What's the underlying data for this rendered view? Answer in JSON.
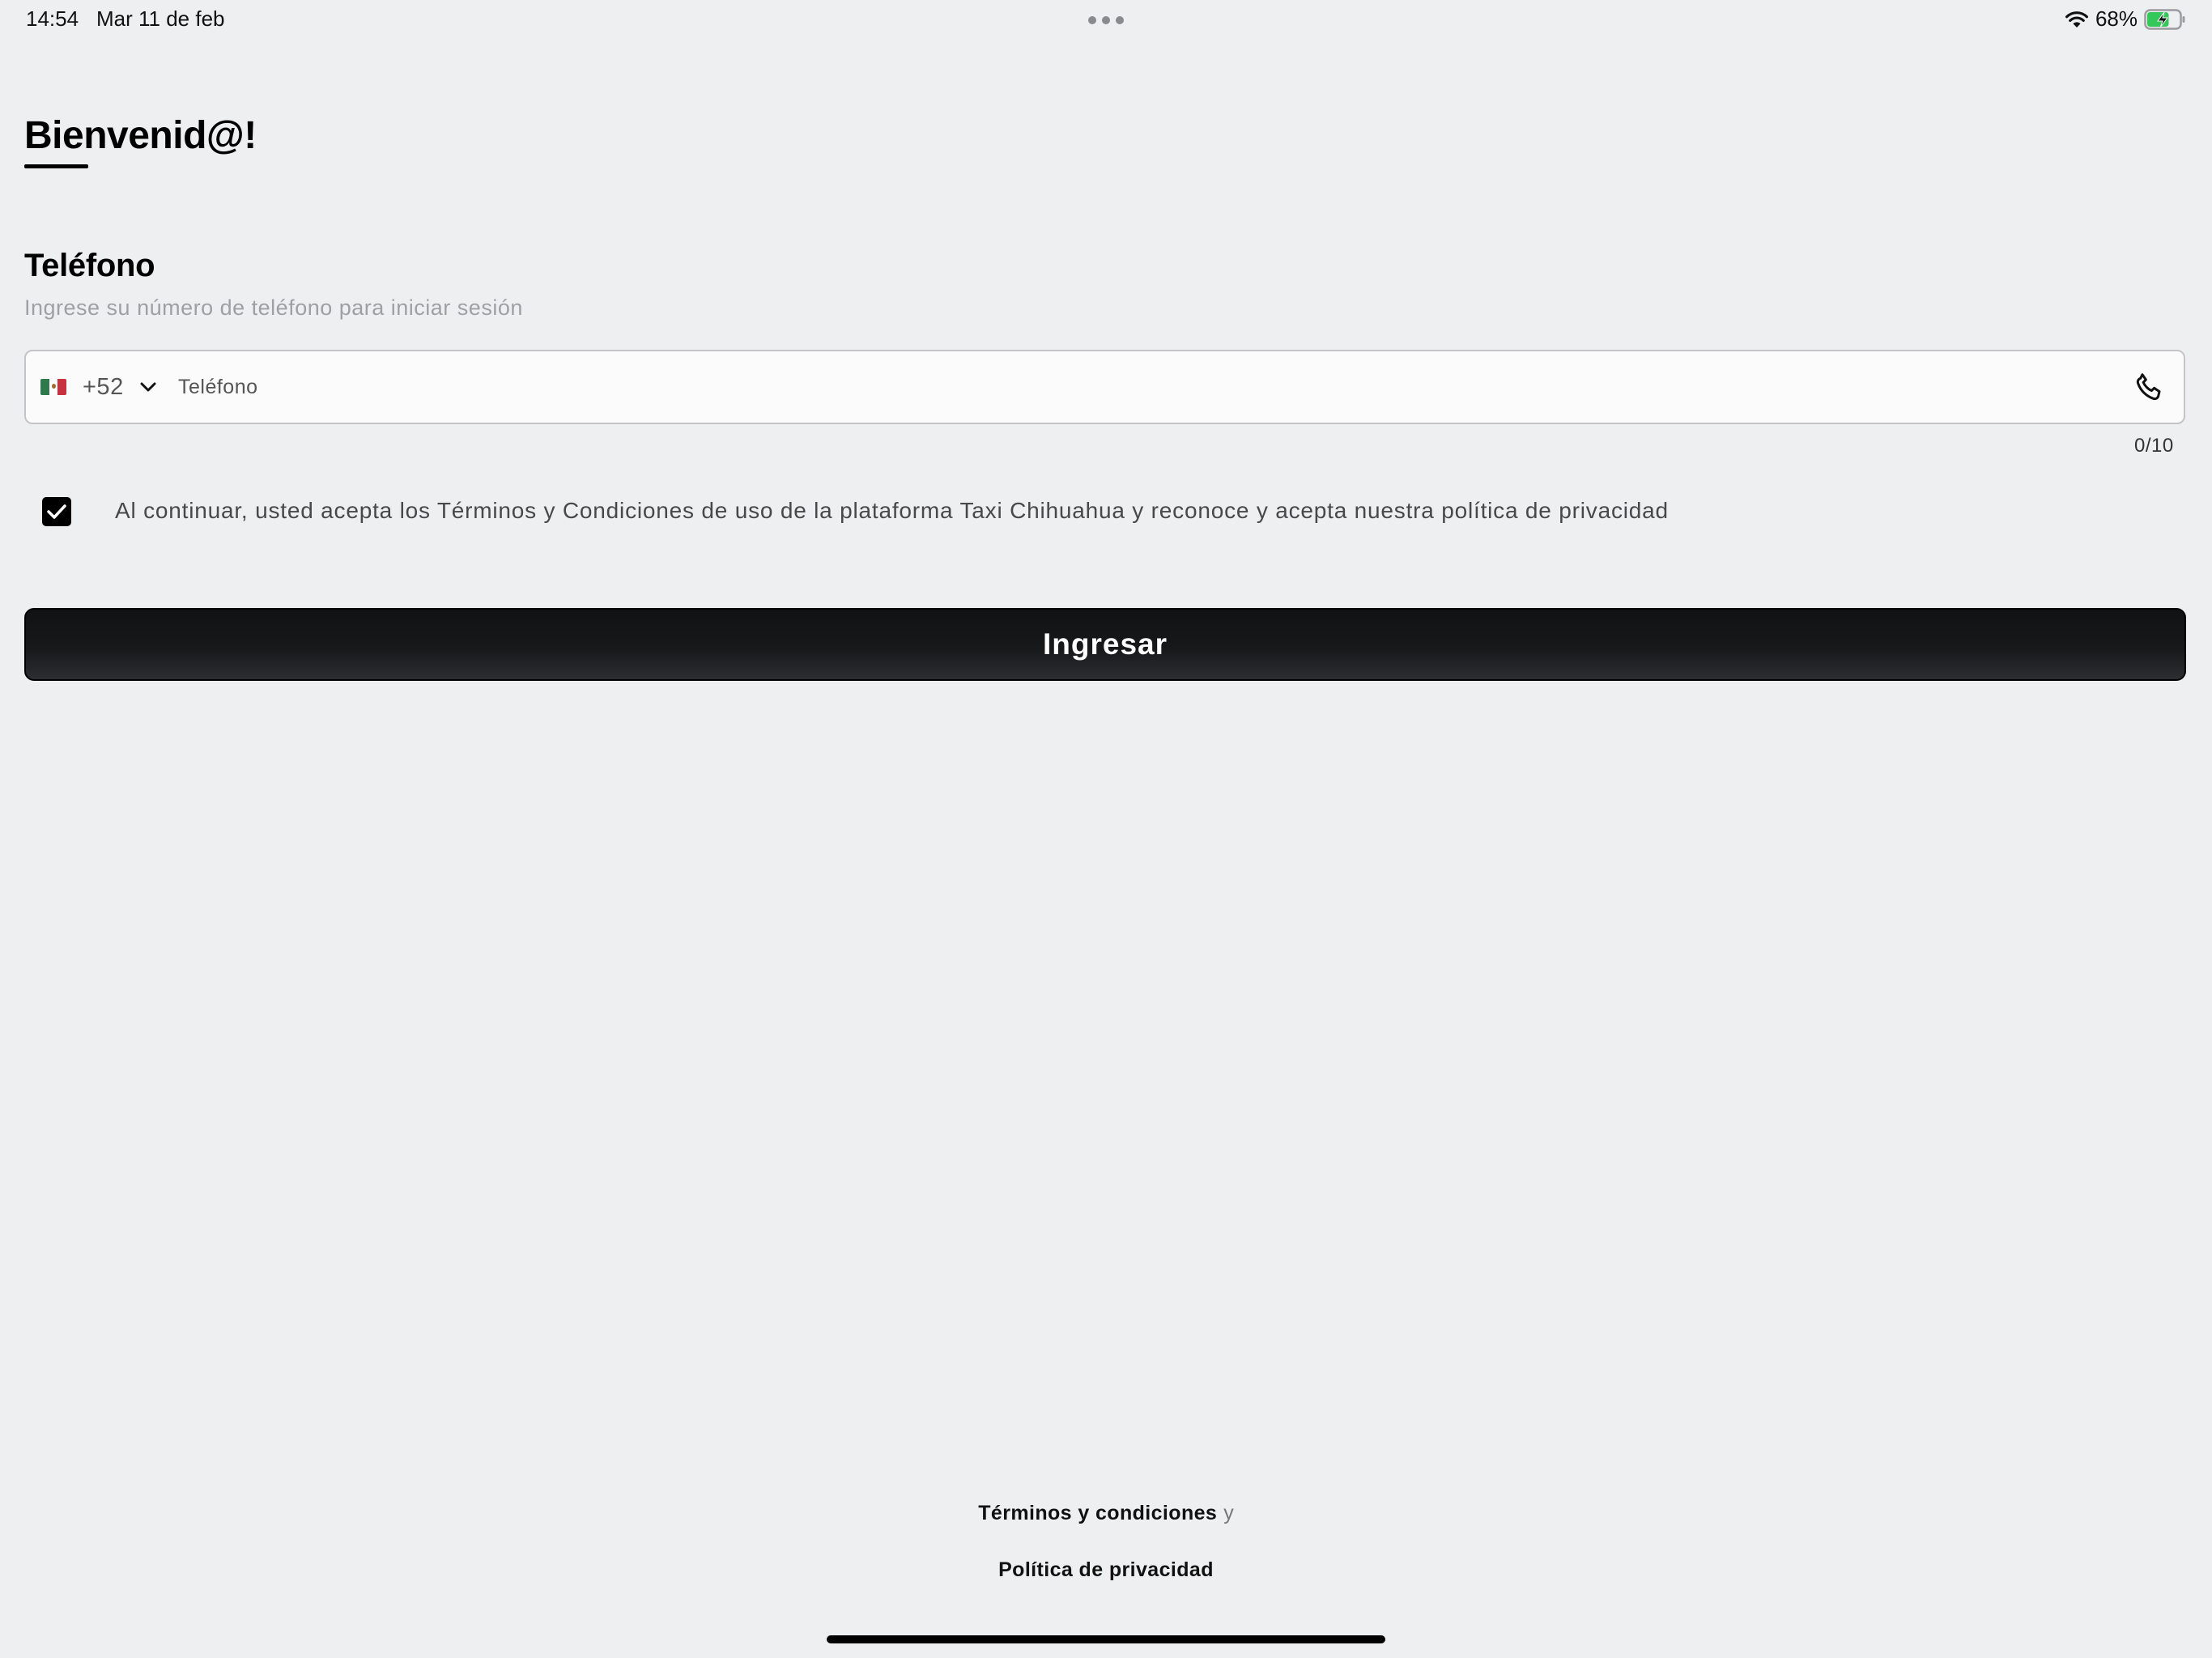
{
  "status_bar": {
    "time": "14:54",
    "date": "Mar 11 de feb",
    "battery_percent": "68%",
    "battery_level": 0.68,
    "battery_charging": true,
    "battery_color": "#34c759"
  },
  "header": {
    "title": "Bienvenid@!"
  },
  "phone_section": {
    "heading": "Teléfono",
    "subtitle": "Ingrese su número de teléfono para iniciar sesión",
    "country_flag": "mexico-flag",
    "dial_code": "+52",
    "input_placeholder": "Teléfono",
    "input_value": "",
    "counter": "0/10",
    "trailing_icon": "phone-icon"
  },
  "terms": {
    "checked": true,
    "text": "Al continuar, usted acepta los Términos y Condiciones de uso de la plataforma Taxi Chihuahua y reconoce y acepta nuestra política de privacidad"
  },
  "submit": {
    "label": "Ingresar"
  },
  "footer": {
    "terms_link": "Términos y condiciones",
    "conjunction": "y",
    "privacy_link": "Política de privacidad"
  },
  "colors": {
    "background": "#eeeff1",
    "button": "#141517",
    "subtitle_text": "#a0a0a4"
  }
}
